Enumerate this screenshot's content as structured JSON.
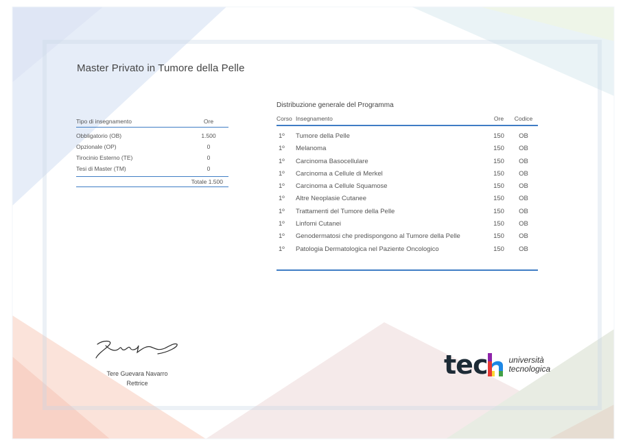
{
  "document": {
    "title": "Master Privato in Tumore della Pelle"
  },
  "summary": {
    "headers": {
      "type": "Tipo di insegnamento",
      "hours": "Ore"
    },
    "rows": [
      {
        "label": "Obbligatorio (OB)",
        "value": "1.500"
      },
      {
        "label": "Opzionale (OP)",
        "value": "0"
      },
      {
        "label": "Tirocinio Esterno (TE)",
        "value": "0"
      },
      {
        "label": "Tesi di Master (TM)",
        "value": "0"
      }
    ],
    "total": "Totale 1.500"
  },
  "program": {
    "title": "Distribuzione generale del Programma",
    "headers": {
      "course": "Corso",
      "subject": "Insegnamento",
      "hours": "Ore",
      "code": "Codice"
    },
    "rows": [
      {
        "course": "1º",
        "subject": "Tumore della Pelle",
        "hours": "150",
        "code": "OB"
      },
      {
        "course": "1º",
        "subject": "Melanoma",
        "hours": "150",
        "code": "OB"
      },
      {
        "course": "1º",
        "subject": "Carcinoma Basocellulare",
        "hours": "150",
        "code": "OB"
      },
      {
        "course": "1º",
        "subject": "Carcinoma a Cellule di Merkel",
        "hours": "150",
        "code": "OB"
      },
      {
        "course": "1º",
        "subject": "Carcinoma a Cellule Squamose",
        "hours": "150",
        "code": "OB"
      },
      {
        "course": "1º",
        "subject": "Altre Neoplasie Cutanee",
        "hours": "150",
        "code": "OB"
      },
      {
        "course": "1º",
        "subject": "Trattamenti del Tumore della Pelle",
        "hours": "150",
        "code": "OB"
      },
      {
        "course": "1º",
        "subject": "Linfomi Cutanei",
        "hours": "150",
        "code": "OB"
      },
      {
        "course": "1º",
        "subject": "Genodermatosi che predispongono al Tumore della Pelle",
        "hours": "150",
        "code": "OB"
      },
      {
        "course": "1º",
        "subject": "Patologia Dermatologica nel Paziente Oncologico",
        "hours": "150",
        "code": "OB"
      }
    ]
  },
  "signatory": {
    "name": "Tere Guevara Navarro",
    "role": "Rettrice"
  },
  "logo": {
    "word": "tec",
    "line1": "università",
    "line2": "tecnologica",
    "colors": [
      "#e53935",
      "#fdd835",
      "#43a047",
      "#1e88e5",
      "#8e24aa"
    ]
  },
  "colors": {
    "accent": "#3e7cc4"
  }
}
